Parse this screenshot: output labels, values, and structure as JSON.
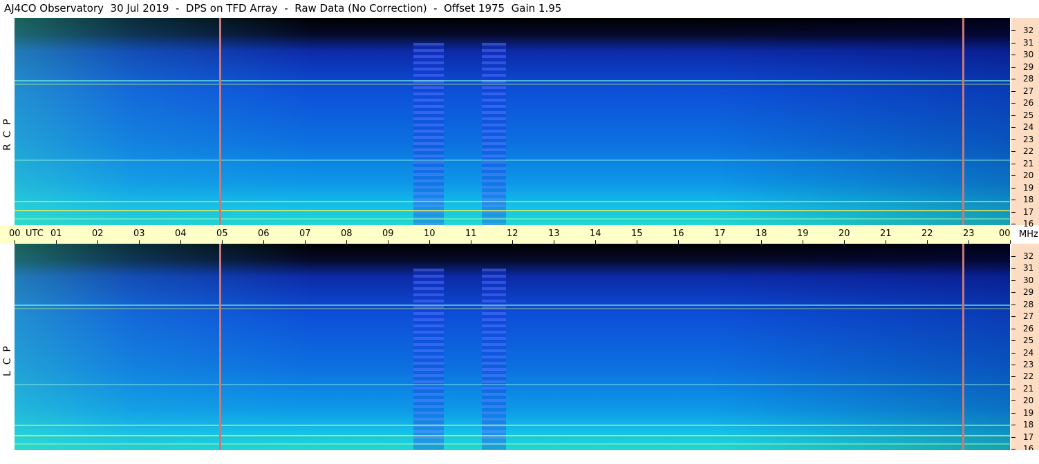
{
  "title": "AJ4CO Observatory  30 Jul 2019  -  DPS on TFD Array  -  Raw Data (No Correction)  -  Offset 1975  Gain 1.95",
  "panels": [
    {
      "id": "rcp",
      "polarization": "R  C  P"
    },
    {
      "id": "lcp",
      "polarization": "L  C  P"
    }
  ],
  "time_axis": {
    "unit": "UTC",
    "labels": [
      "00",
      "01",
      "02",
      "03",
      "04",
      "05",
      "06",
      "07",
      "08",
      "09",
      "10",
      "11",
      "12",
      "13",
      "14",
      "15",
      "16",
      "17",
      "18",
      "19",
      "20",
      "21",
      "22",
      "23",
      "00"
    ]
  },
  "freq_axis": {
    "unit": "MHz",
    "labels": [
      "32",
      "31",
      "30",
      "29",
      "28",
      "27",
      "26",
      "25",
      "24",
      "23",
      "22",
      "21",
      "20",
      "19",
      "18",
      "17",
      "16"
    ]
  },
  "colors": {
    "axis_bg": "#ffffc8",
    "freq_axis_bg": "#fcdcc2",
    "marker": "#c87a7a"
  }
}
